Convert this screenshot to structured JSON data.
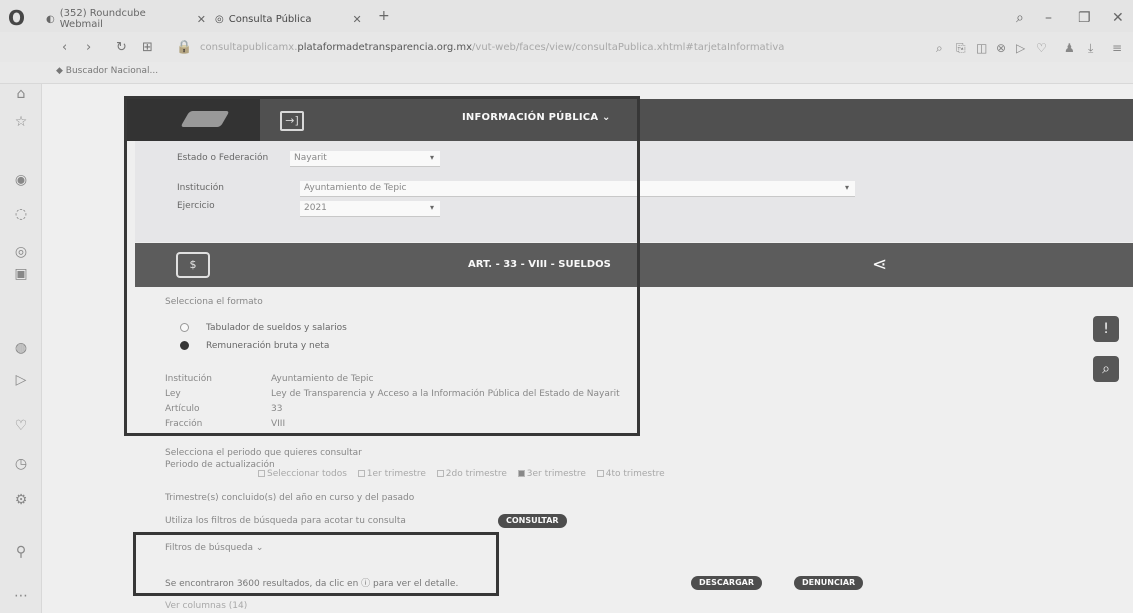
{
  "browser": {
    "tabs": [
      {
        "label": "(352) Roundcube Webmail"
      },
      {
        "label": "Consulta Pública"
      }
    ],
    "url_prefix": "consultapublicamx.",
    "url_domain": "plataformadetransparencia.org.mx",
    "url_suffix": "/vut-web/faces/view/consultaPublica.xhtml#tarjetaInformativa",
    "bookmark": "Buscador Nacional..."
  },
  "portal": {
    "menu_label": "INFORMACIÓN PÚBLICA ⌄",
    "filters": {
      "estado_label": "Estado o Federación",
      "estado_value": "Nayarit",
      "institucion_label": "Institución",
      "institucion_value": "Ayuntamiento de Tepic",
      "ejercicio_label": "Ejercicio",
      "ejercicio_value": "2021"
    },
    "article_title": "ART. - 33 - VIII - SUELDOS",
    "format_prompt": "Selecciona el formato",
    "formats": [
      {
        "label": "Tabulador de sueldos y salarios",
        "selected": false
      },
      {
        "label": "Remuneración bruta y neta",
        "selected": true
      }
    ],
    "details": [
      {
        "label": "Institución",
        "value": "Ayuntamiento de Tepic"
      },
      {
        "label": "Ley",
        "value": "Ley de Transparencia y Acceso a la Información Pública del Estado de Nayarit"
      },
      {
        "label": "Artículo",
        "value": "33"
      },
      {
        "label": "Fracción",
        "value": "VIII"
      }
    ],
    "period_prompt": "Selecciona el periodo que quieres consultar",
    "period_label": "Periodo de actualización",
    "periods": [
      "Seleccionar todos",
      "1er trimestre",
      "2do trimestre",
      "3er trimestre",
      "4to trimestre"
    ],
    "period_note": "Trimestre(s) concluido(s) del año en curso y del pasado",
    "filter_hint": "Utiliza los filtros de búsqueda para acotar tu consulta",
    "consult_button": "CONSULTAR",
    "filters_toggle": "Filtros de búsqueda ⌄",
    "results_text": "Se encontraron 3600 resultados, da clic en ⓘ para ver el detalle.",
    "download_button": "DESCARGAR",
    "report_button": "DENUNCIAR",
    "more_text": "Ver columnas (14)"
  }
}
